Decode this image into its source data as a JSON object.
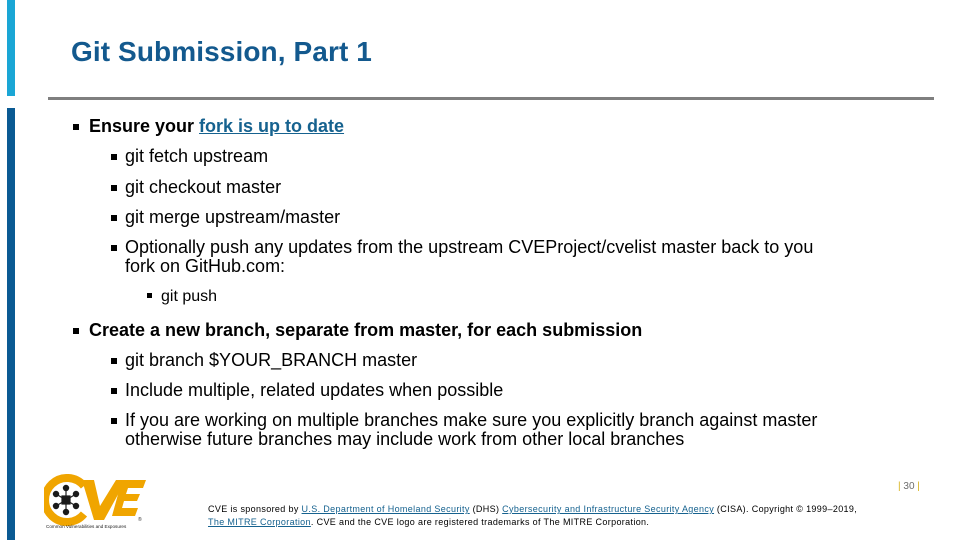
{
  "slide": {
    "title": "Git Submission, Part 1",
    "colors": {
      "title": "#13598e",
      "accent_light": "#1aa6d5",
      "accent_dark": "#0a5a93",
      "link": "#16628f",
      "divider": "#7f7f7f",
      "page_pipe": "#d8b21a"
    }
  },
  "body": {
    "section1": {
      "prefix": "Ensure your ",
      "link_text": "fork is up to date",
      "items": [
        "git fetch upstream",
        "git checkout master",
        "git merge upstream/master"
      ],
      "optional_line1": "Optionally push any updates from the upstream CVEProject/cvelist master back to you",
      "optional_line2": "fork on GitHub.com:",
      "subitem": "git push"
    },
    "section2": {
      "heading": "Create a new branch, separate from master, for each submission",
      "items": [
        "git branch $YOUR_BRANCH master",
        "Include multiple, related updates when possible"
      ],
      "last_line1": "If you are working on multiple branches make sure you explicitly branch against master",
      "last_line2": "otherwise future branches may include work from other local branches"
    }
  },
  "footer": {
    "logo": {
      "name": "cve-logo",
      "wordmark": "CVE",
      "tagline": "Common Vulnerabilities and Exposures",
      "registered": "®"
    },
    "sponsor_prefix": "CVE is sponsored by ",
    "dhs_link": "U.S. Department of Homeland Security",
    "dhs_abbr": " (DHS) ",
    "cisa_link": "Cybersecurity and Infrastructure Security Agency",
    "cisa_suffix": " (CISA). Copyright © 1999–2019,",
    "mitre_link": "The MITRE Corporation",
    "trademark_text": ". CVE and the CVE logo are registered trademarks of The MITRE Corporation.",
    "page_number": "30",
    "page_pipe": "|"
  }
}
